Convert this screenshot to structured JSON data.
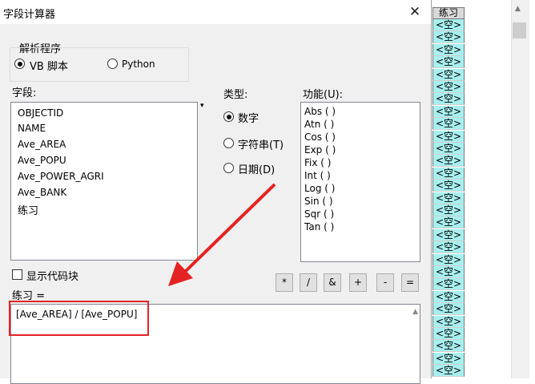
{
  "window": {
    "title": "字段计算器",
    "close_label": "✕"
  },
  "parser": {
    "label": "解析程序",
    "options": [
      "VB 脚本",
      "Python"
    ],
    "selected": "VB 脚本"
  },
  "fields": {
    "label": "字段:",
    "items": [
      "OBJECTID",
      "NAME",
      "Ave_AREA",
      "Ave_POPU",
      "Ave_POWER_AGRI",
      "Ave_BANK",
      "练习"
    ],
    "selected": "Ave_POPU"
  },
  "type": {
    "label": "类型:",
    "options": [
      "数字",
      "字符串(T)",
      "日期(D)"
    ],
    "selected": "数字"
  },
  "functions": {
    "label": "功能(U):",
    "items": [
      "Abs ( )",
      "Atn ( )",
      "Cos ( )",
      "Exp ( )",
      "Fix ( )",
      "Int ( )",
      "Log ( )",
      "Sin ( )",
      "Sqr ( )",
      "Tan ( )"
    ]
  },
  "show_code_block": {
    "label": "显示代码块",
    "checked": false
  },
  "operators": [
    "*",
    "/",
    "&",
    "+",
    "-",
    "="
  ],
  "expression": {
    "label": "练习 =",
    "value": "[Ave_AREA] / [Ave_POPU]"
  },
  "attribute_table": {
    "column": "练习",
    "cell_value": "<空>",
    "row_count": 29
  },
  "colors": {
    "annotation": "#e52222",
    "null_cell": "#a8efef"
  }
}
